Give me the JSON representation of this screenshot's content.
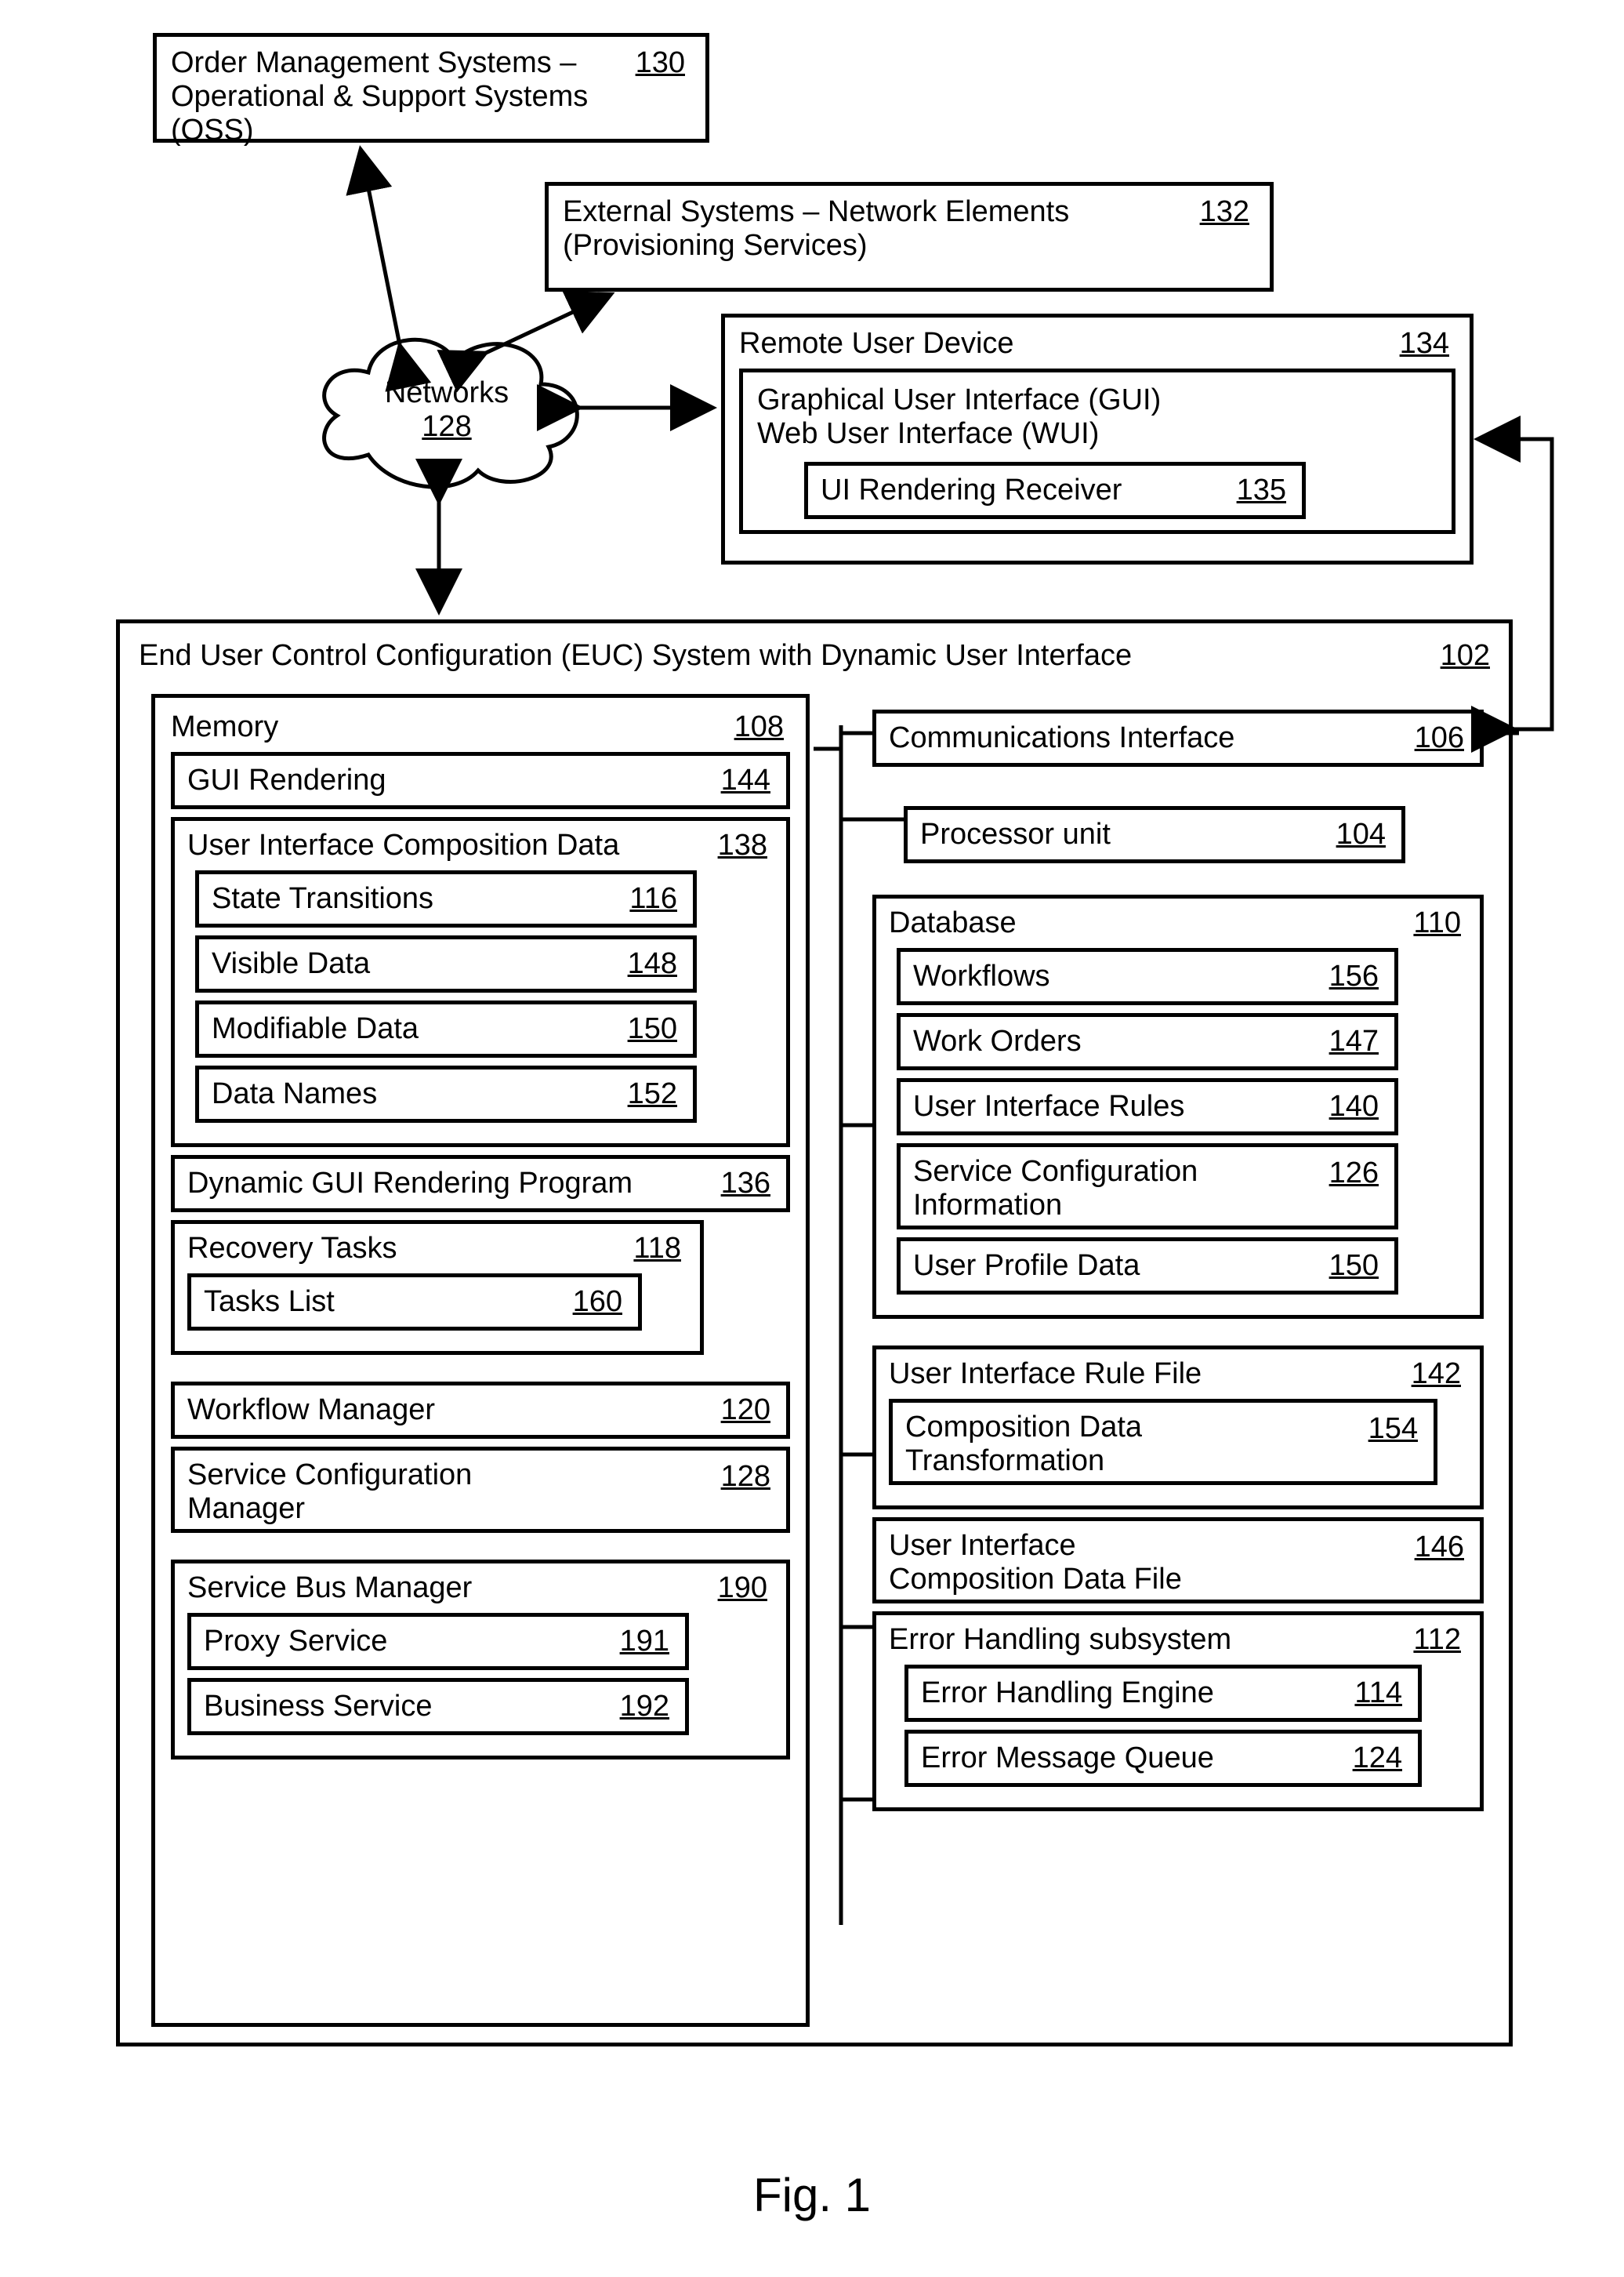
{
  "oms": {
    "line1": "Order Management Systems  –",
    "line2": "Operational & Support Systems (OSS)",
    "ref": "130"
  },
  "ext": {
    "line1": "External Systems – Network Elements",
    "line2": "(Provisioning Services)",
    "ref": "132"
  },
  "remote": {
    "title": "Remote User Device",
    "ref": "134",
    "gui1": "Graphical User Interface (GUI)",
    "gui2": "Web User Interface (WUI)",
    "uir": {
      "label": "UI Rendering Receiver",
      "ref": "135"
    }
  },
  "networks": {
    "label": "Networks",
    "ref": "128"
  },
  "euc": {
    "title": "End User Control Configuration (EUC) System with Dynamic User Interface",
    "ref": "102"
  },
  "memory": {
    "title": "Memory",
    "ref": "108",
    "guiRendering": {
      "label": "GUI Rendering",
      "ref": "144"
    },
    "uicd": {
      "title": "User Interface Composition Data",
      "ref": "138",
      "state": {
        "label": "State Transitions",
        "ref": "116"
      },
      "visible": {
        "label": "Visible Data",
        "ref": "148"
      },
      "mod": {
        "label": "Modifiable Data",
        "ref": "150"
      },
      "names": {
        "label": "Data Names",
        "ref": "152"
      }
    },
    "dguir": {
      "label": "Dynamic GUI Rendering Program",
      "ref": "136"
    },
    "recovery": {
      "title": "Recovery Tasks",
      "ref": "118",
      "tasks": {
        "label": "Tasks List",
        "ref": "160"
      }
    },
    "workflow": {
      "label": "Workflow Manager",
      "ref": "120"
    },
    "scm": {
      "label": "Service Configuration Manager",
      "ref": "128"
    },
    "sbm": {
      "title": "Service Bus Manager",
      "ref": "190",
      "proxy": {
        "label": "Proxy Service",
        "ref": "191"
      },
      "biz": {
        "label": "Business Service",
        "ref": "192"
      }
    }
  },
  "right": {
    "comm": {
      "label": "Communications Interface",
      "ref": "106"
    },
    "proc": {
      "label": "Processor unit",
      "ref": "104"
    },
    "db": {
      "title": "Database",
      "ref": "110",
      "workflows": {
        "label": "Workflows",
        "ref": "156"
      },
      "workOrders": {
        "label": "Work Orders",
        "ref": "147"
      },
      "uiRules": {
        "label": "User Interface Rules",
        "ref": "140"
      },
      "sci": {
        "label": "Service Configuration Information",
        "ref": "126"
      },
      "upd": {
        "label": "User Profile Data",
        "ref": "150"
      }
    },
    "uirf": {
      "title": "User Interface Rule File",
      "ref": "142",
      "cdt": {
        "label": "Composition Data Transformation",
        "ref": "154"
      }
    },
    "uicdf": {
      "label": "User Interface Composition Data File",
      "ref": "146"
    },
    "err": {
      "title": "Error Handling subsystem",
      "ref": "112",
      "engine": {
        "label": "Error Handling Engine",
        "ref": "114"
      },
      "queue": {
        "label": "Error Message Queue",
        "ref": "124"
      }
    }
  },
  "figure": "Fig. 1"
}
